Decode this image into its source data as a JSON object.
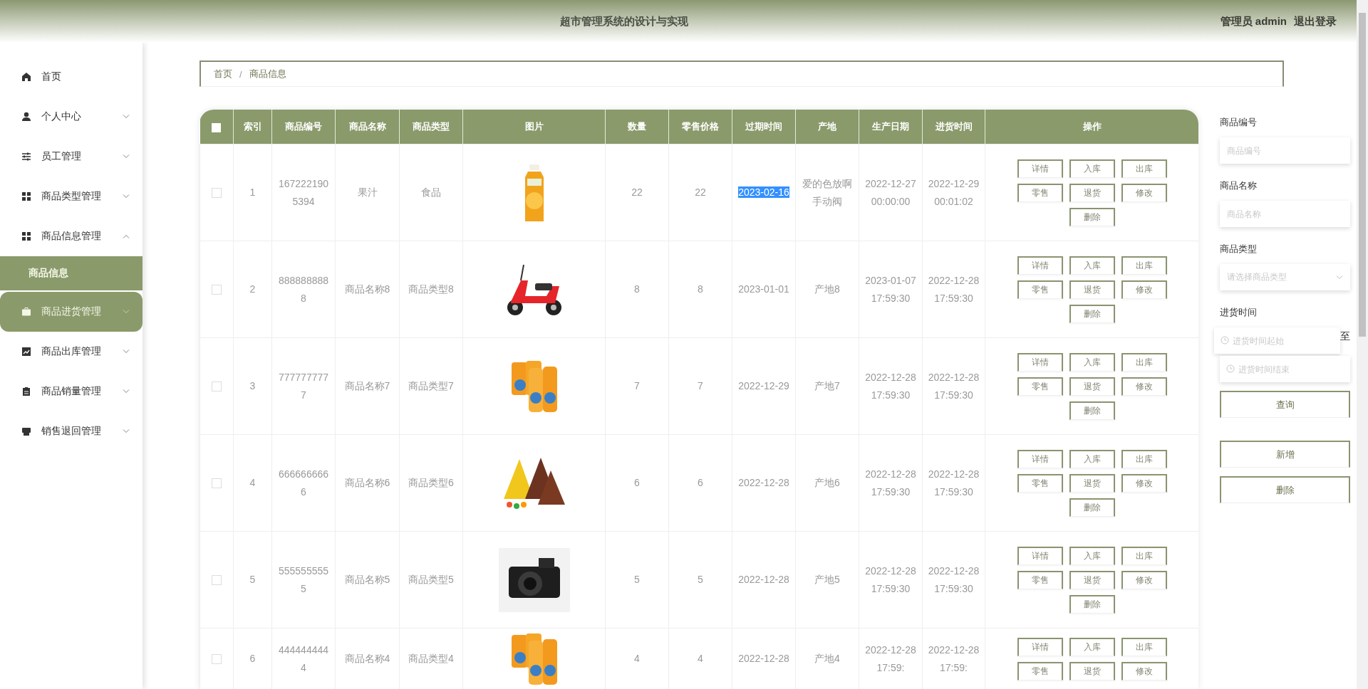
{
  "header": {
    "title": "超市管理系统的设计与实现",
    "user": "管理员 admin",
    "logout": "退出登录"
  },
  "sidebar": {
    "items": [
      {
        "label": "首页",
        "kind": "link",
        "selected": false
      },
      {
        "label": "个人中心",
        "kind": "menu",
        "expanded": false,
        "selected": false
      },
      {
        "label": "员工管理",
        "kind": "menu",
        "expanded": false,
        "selected": false
      },
      {
        "label": "商品类型管理",
        "kind": "menu",
        "expanded": false,
        "selected": false
      },
      {
        "label": "商品信息管理",
        "kind": "menu",
        "expanded": true,
        "selected": false,
        "children": [
          {
            "label": "商品信息",
            "selected": true
          }
        ]
      },
      {
        "label": "商品进货管理",
        "kind": "menu",
        "expanded": false,
        "selected": true
      },
      {
        "label": "商品出库管理",
        "kind": "menu",
        "expanded": false,
        "selected": false
      },
      {
        "label": "商品销量管理",
        "kind": "menu",
        "expanded": false,
        "selected": false
      },
      {
        "label": "销售退回管理",
        "kind": "menu",
        "expanded": false,
        "selected": false
      }
    ]
  },
  "breadcrumb": {
    "items": [
      "首页",
      "商品信息"
    ],
    "separator": "/"
  },
  "table": {
    "select_all_checked": false,
    "columns": [
      "索引",
      "商品编号",
      "商品名称",
      "商品类型",
      "图片",
      "数量",
      "零售价格",
      "过期时间",
      "产地",
      "生产日期",
      "进货时间",
      "操作"
    ],
    "rows": [
      {
        "checked": false,
        "index": "1",
        "code": "1672221905394",
        "name": "果汁",
        "type": "食品",
        "picture": {
          "kind": "picture"
        },
        "quantity": "22",
        "price": "22",
        "expiry": "2023-02-16",
        "expiry_selected": true,
        "origin": "爱的色放啊手动阀",
        "produced": "2022-12-27 00:00:00",
        "stocked": "2022-12-29 00:01:02",
        "actions": [
          "详情",
          "入库",
          "出库",
          "零售",
          "退货",
          "修改",
          "删除"
        ]
      },
      {
        "checked": false,
        "index": "2",
        "code": "8888888888",
        "name": "商品名称8",
        "type": "商品类型8",
        "picture": {
          "kind": "picture"
        },
        "quantity": "8",
        "price": "8",
        "expiry": "2023-01-01",
        "expiry_selected": false,
        "origin": "产地8",
        "produced": "2023-01-07 17:59:30",
        "stocked": "2022-12-28 17:59:30",
        "actions": [
          "详情",
          "入库",
          "出库",
          "零售",
          "退货",
          "修改",
          "删除"
        ]
      },
      {
        "checked": false,
        "index": "3",
        "code": "7777777777",
        "name": "商品名称7",
        "type": "商品类型7",
        "picture": {
          "kind": "picture"
        },
        "quantity": "7",
        "price": "7",
        "expiry": "2022-12-29",
        "expiry_selected": false,
        "origin": "产地7",
        "produced": "2022-12-28 17:59:30",
        "stocked": "2022-12-28 17:59:30",
        "actions": [
          "详情",
          "入库",
          "出库",
          "零售",
          "退货",
          "修改",
          "删除"
        ]
      },
      {
        "checked": false,
        "index": "4",
        "code": "6666666666",
        "name": "商品名称6",
        "type": "商品类型6",
        "picture": {
          "kind": "picture"
        },
        "quantity": "6",
        "price": "6",
        "expiry": "2022-12-28",
        "expiry_selected": false,
        "origin": "产地6",
        "produced": "2022-12-28 17:59:30",
        "stocked": "2022-12-28 17:59:30",
        "actions": [
          "详情",
          "入库",
          "出库",
          "零售",
          "退货",
          "修改",
          "删除"
        ]
      },
      {
        "checked": false,
        "index": "5",
        "code": "5555555555",
        "name": "商品名称5",
        "type": "商品类型5",
        "picture": {
          "kind": "picture"
        },
        "quantity": "5",
        "price": "5",
        "expiry": "2022-12-28",
        "expiry_selected": false,
        "origin": "产地5",
        "produced": "2022-12-28 17:59:30",
        "stocked": "2022-12-28 17:59:30",
        "actions": [
          "详情",
          "入库",
          "出库",
          "零售",
          "退货",
          "修改",
          "删除"
        ]
      },
      {
        "checked": false,
        "index": "6",
        "code": "4444444444",
        "name": "商品名称4",
        "type": "商品类型4",
        "picture": {
          "kind": "picture"
        },
        "quantity": "4",
        "price": "4",
        "expiry": "2022-12-28",
        "expiry_selected": false,
        "origin": "产地4",
        "produced": "2022-12-28 17:59:",
        "stocked": "2022-12-28 17:59:",
        "actions": [
          "详情",
          "入库",
          "出库",
          "零售",
          "退货",
          "修改"
        ]
      }
    ]
  },
  "filters": {
    "fields": [
      {
        "label": "商品编号",
        "kind": "text",
        "placeholder": "商品编号"
      },
      {
        "label": "商品名称",
        "kind": "text",
        "placeholder": "商品名称"
      },
      {
        "label": "商品类型",
        "kind": "select",
        "placeholder": "请选择商品类型"
      },
      {
        "label": "进货时间",
        "kind": "daterange",
        "start_placeholder": "进货时间起始",
        "separator": "至",
        "end_placeholder": "进货时间结束"
      }
    ],
    "search_button": "查询",
    "buttons": [
      "新增",
      "删除"
    ]
  }
}
